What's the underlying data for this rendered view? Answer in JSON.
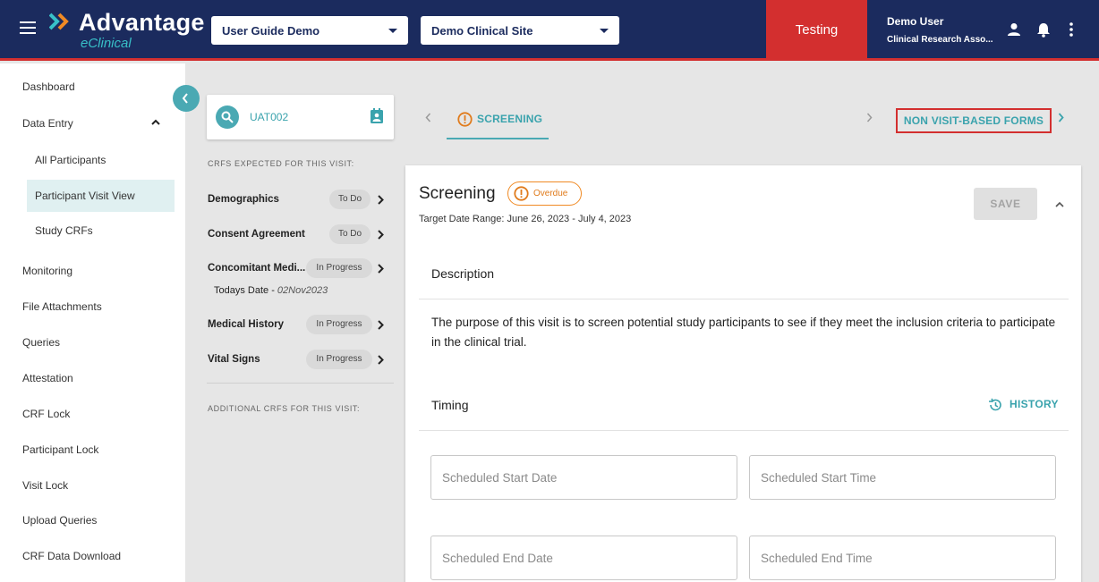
{
  "header": {
    "logo_title": "Advantage",
    "logo_subtitle": "eClinical",
    "study_select": "User Guide Demo",
    "site_select": "Demo Clinical Site",
    "environment": "Testing",
    "user_name": "Demo User",
    "user_role": "Clinical Research Asso...",
    "icons": [
      "menu-icon",
      "person-icon",
      "bell-icon",
      "more-vert-icon"
    ],
    "brand_color": "#1b2b5e",
    "env_color": "#d32f2f"
  },
  "sidebar": {
    "items": [
      {
        "label": "Dashboard"
      },
      {
        "label": "Data Entry"
      },
      {
        "label": "All Participants"
      },
      {
        "label": "Participant Visit View"
      },
      {
        "label": "Study CRFs"
      },
      {
        "label": "Monitoring"
      },
      {
        "label": "File Attachments"
      },
      {
        "label": "Queries"
      },
      {
        "label": "Attestation"
      },
      {
        "label": "CRF Lock"
      },
      {
        "label": "Participant Lock"
      },
      {
        "label": "Visit Lock"
      },
      {
        "label": "Upload Queries"
      },
      {
        "label": "CRF Data Download"
      }
    ],
    "active_item": "Participant Visit View"
  },
  "participant": {
    "id": "UAT002"
  },
  "crfs": {
    "expected_heading": "CRFS EXPECTED FOR THIS VISIT:",
    "expected": [
      {
        "name": "Demographics",
        "status": "To Do"
      },
      {
        "name": "Consent Agreement",
        "status": "To Do"
      },
      {
        "name": "Concomitant Medi...",
        "status": "In Progress"
      },
      {
        "name": "Medical History",
        "status": "In Progress"
      },
      {
        "name": "Vital Signs",
        "status": "In Progress"
      }
    ],
    "todays_date_label": "Todays Date - ",
    "todays_date_value": "02Nov2023",
    "additional_heading": "ADDITIONAL CRFS FOR THIS VISIT:"
  },
  "visit_nav": {
    "current_tab": "SCREENING",
    "non_visit_forms": "NON VISIT-BASED FORMS"
  },
  "visit": {
    "title": "Screening",
    "status": "Overdue",
    "target_range": "Target Date Range: June 26, 2023 - July 4, 2023",
    "save_label": "SAVE",
    "description_title": "Description",
    "description_text": "The purpose of this visit is to screen potential study participants to see if they meet the inclusion criteria to participate in the clinical trial.",
    "timing_title": "Timing",
    "history_label": "HISTORY",
    "fields": {
      "scheduled_start_date": {
        "placeholder": "Scheduled Start Date",
        "value": ""
      },
      "scheduled_start_time": {
        "placeholder": "Scheduled Start Time",
        "value": ""
      },
      "scheduled_end_date": {
        "placeholder": "Scheduled End Date",
        "value": ""
      },
      "scheduled_end_time": {
        "placeholder": "Scheduled End Time",
        "value": ""
      }
    },
    "accent_color": "#3aa3ad",
    "overdue_color": "#e07b1c"
  }
}
